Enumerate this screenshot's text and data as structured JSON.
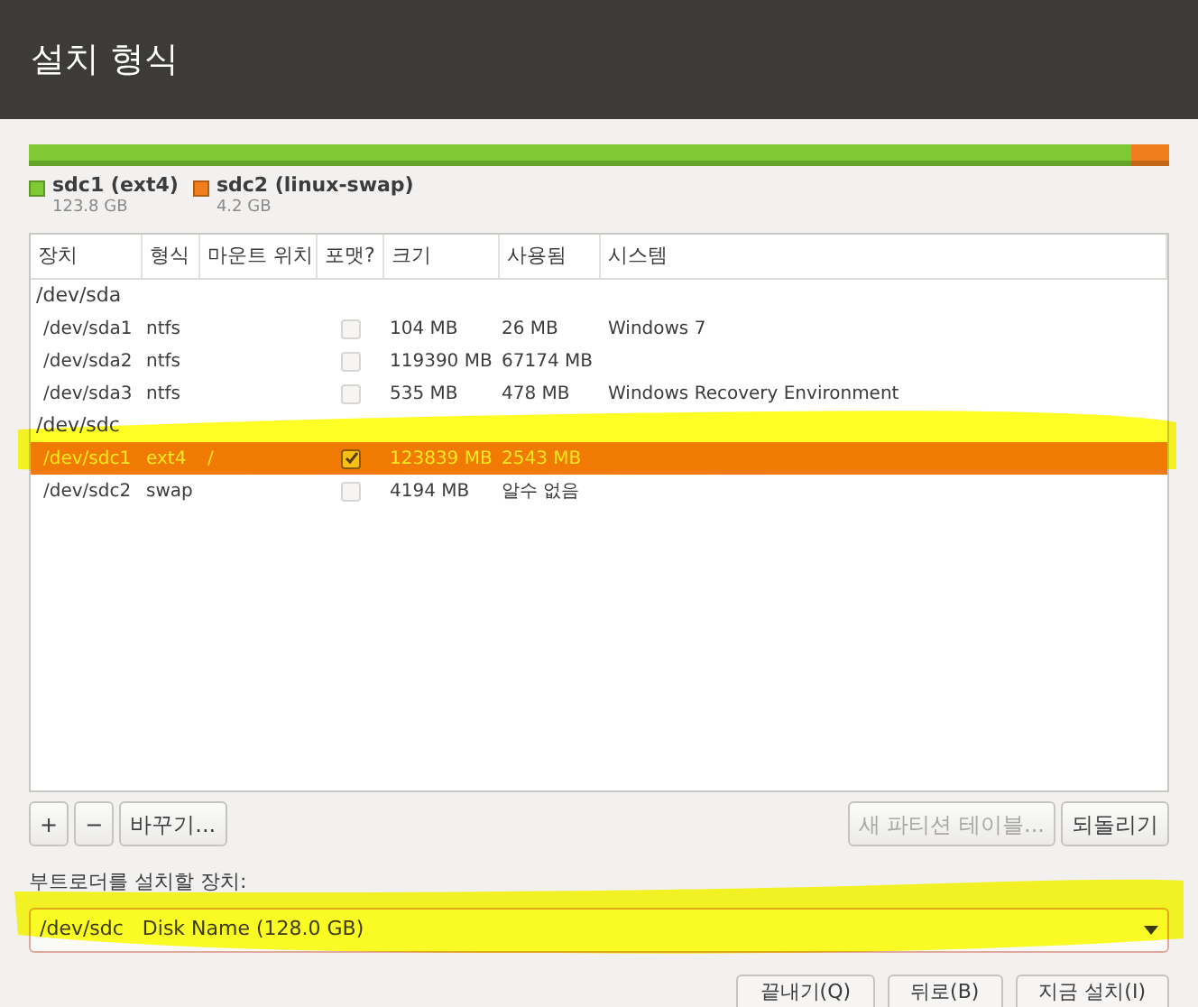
{
  "window": {
    "title": "설치 형식"
  },
  "disk_bar": {
    "segments": [
      {
        "name": "sdc1 (ext4)",
        "size": "123.8 GB",
        "color": "#7ec934"
      },
      {
        "name": "sdc2 (linux-swap)",
        "size": "4.2 GB",
        "color": "#f07e1c"
      }
    ]
  },
  "table": {
    "columns": [
      "장치",
      "형식",
      "마운트 위치",
      "포맷?",
      "크기",
      "사용됨",
      "시스템"
    ],
    "rows": [
      {
        "kind": "disk",
        "device": "/dev/sda"
      },
      {
        "kind": "partition",
        "device": "/dev/sda1",
        "type": "ntfs",
        "format": false,
        "selected": false,
        "size": "104 MB",
        "used": "26 MB",
        "system": "Windows 7"
      },
      {
        "kind": "partition",
        "device": "/dev/sda2",
        "type": "ntfs",
        "format": false,
        "selected": false,
        "size": "119390 MB",
        "used": "67174 MB"
      },
      {
        "kind": "partition",
        "device": "/dev/sda3",
        "type": "ntfs",
        "format": false,
        "selected": false,
        "size": "535 MB",
        "used": "478 MB",
        "system": "Windows Recovery Environment"
      },
      {
        "kind": "disk",
        "device": "/dev/sdc"
      },
      {
        "kind": "partition",
        "device": "/dev/sdc1",
        "type": "ext4",
        "mount": "/",
        "format": true,
        "selected": true,
        "size": "123839 MB",
        "used": "2543 MB"
      },
      {
        "kind": "partition",
        "device": "/dev/sdc2",
        "type": "swap",
        "format": false,
        "selected": false,
        "size": "4194 MB",
        "used": "알수 없음"
      }
    ]
  },
  "table_buttons": [
    {
      "label": "+",
      "disabled": false
    },
    {
      "label": "−",
      "disabled": false
    },
    {
      "label": "바꾸기...",
      "disabled": false
    }
  ],
  "table_buttons_right": [
    {
      "label": "새 파티션 테이블...",
      "disabled": true
    },
    {
      "label": "되돌리기",
      "disabled": false
    }
  ],
  "bootloader": {
    "label": "부트로더를 설치할 장치:",
    "value": "/dev/sdc",
    "detail": "Disk Name (128.0 GB)"
  },
  "footer_buttons": [
    "끝내기(Q)",
    "뒤로(B)",
    "지금 설치(I)"
  ]
}
